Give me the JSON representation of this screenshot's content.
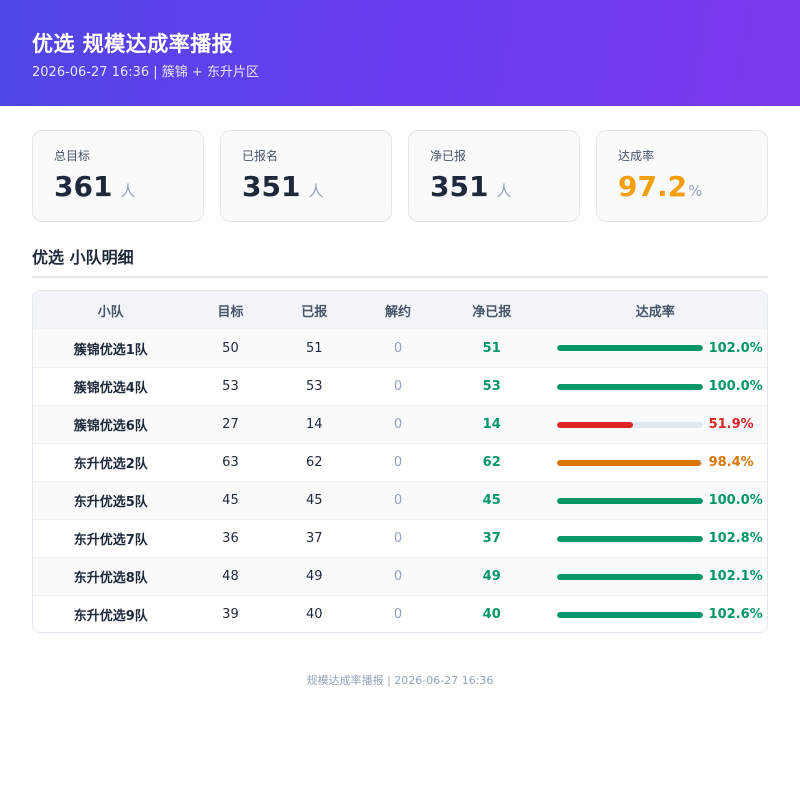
{
  "header": {
    "title": "优选 规模达成率播报",
    "subtitle": "2026-06-27 16:36 | 簇锦 + 东升片区"
  },
  "cards": [
    {
      "label": "总目标",
      "value": "361",
      "unit": "人"
    },
    {
      "label": "已报名",
      "value": "351",
      "unit": "人"
    },
    {
      "label": "净已报",
      "value": "351",
      "unit": "人"
    },
    {
      "label": "达成率",
      "value": "97.2",
      "unit": "%"
    }
  ],
  "section": {
    "title": "优选 小队明细"
  },
  "table": {
    "headers": [
      "小队",
      "目标",
      "已报",
      "解约",
      "净已报",
      "达成率"
    ],
    "rows": [
      {
        "team": "簇锦优选1队",
        "target": "50",
        "reported": "51",
        "cancelled": "0",
        "net": "51",
        "rate_text": "102.0%",
        "rate": 1.02,
        "status": "green"
      },
      {
        "team": "簇锦优选4队",
        "target": "53",
        "reported": "53",
        "cancelled": "0",
        "net": "53",
        "rate_text": "100.0%",
        "rate": 1.0,
        "status": "green"
      },
      {
        "team": "簇锦优选6队",
        "target": "27",
        "reported": "14",
        "cancelled": "0",
        "net": "14",
        "rate_text": "51.9%",
        "rate": 0.519,
        "status": "red"
      },
      {
        "team": "东升优选2队",
        "target": "63",
        "reported": "62",
        "cancelled": "0",
        "net": "62",
        "rate_text": "98.4%",
        "rate": 0.984,
        "status": "orange"
      },
      {
        "team": "东升优选5队",
        "target": "45",
        "reported": "45",
        "cancelled": "0",
        "net": "45",
        "rate_text": "100.0%",
        "rate": 1.0,
        "status": "green"
      },
      {
        "team": "东升优选7队",
        "target": "36",
        "reported": "37",
        "cancelled": "0",
        "net": "37",
        "rate_text": "102.8%",
        "rate": 1.028,
        "status": "green"
      },
      {
        "team": "东升优选8队",
        "target": "48",
        "reported": "49",
        "cancelled": "0",
        "net": "49",
        "rate_text": "102.1%",
        "rate": 1.021,
        "status": "green"
      },
      {
        "team": "东升优选9队",
        "target": "39",
        "reported": "40",
        "cancelled": "0",
        "net": "40",
        "rate_text": "102.6%",
        "rate": 1.026,
        "status": "green"
      }
    ]
  },
  "colors": {
    "green": "#059669",
    "red": "#dc2626",
    "orange": "#d97706",
    "rate_accent": "#f59e0b",
    "header_start": "#4f46e5",
    "header_end": "#7c3aed"
  },
  "footer": {
    "text": "规模达成率播报 | 2026-06-27 16:36"
  }
}
